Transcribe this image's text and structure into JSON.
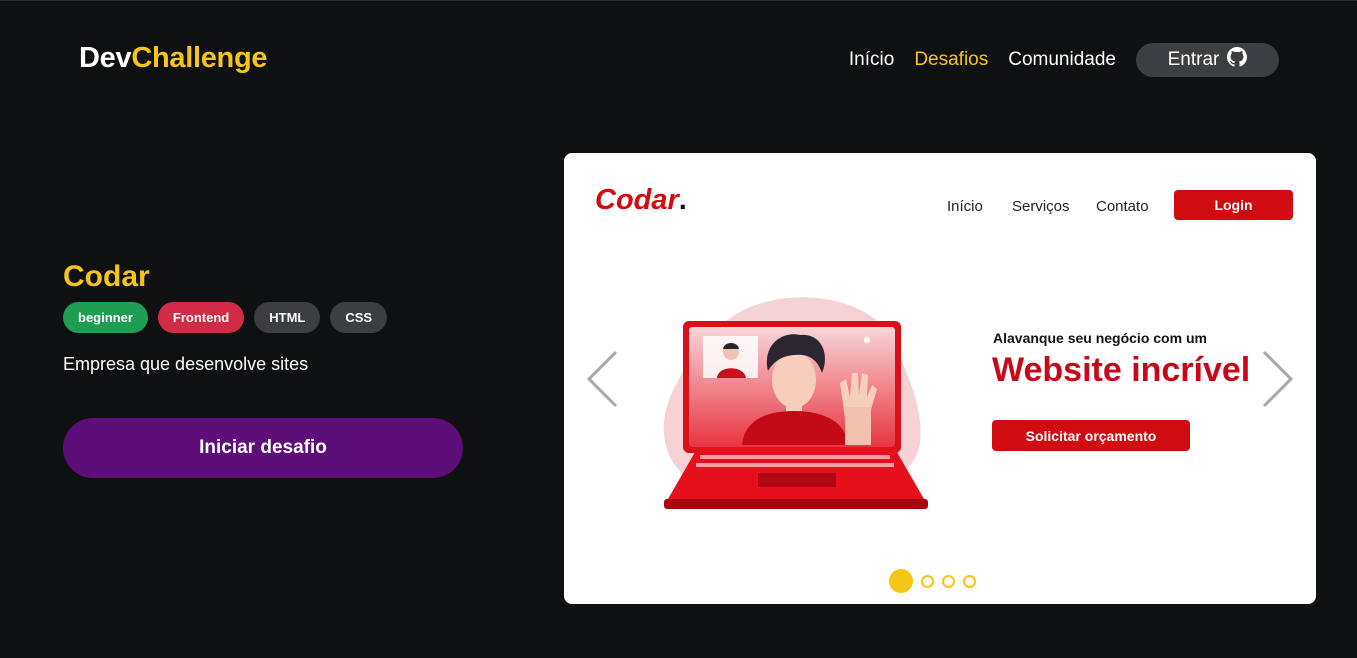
{
  "header": {
    "logo_dev": "Dev",
    "logo_challenge": "Challenge",
    "nav": [
      {
        "label": "Início",
        "active": false
      },
      {
        "label": "Desafios",
        "active": true
      },
      {
        "label": "Comunidade",
        "active": false
      }
    ],
    "login_label": "Entrar",
    "login_icon": "github-icon"
  },
  "challenge": {
    "title": "Codar",
    "tags": [
      {
        "label": "beginner",
        "color": "#1e9e52"
      },
      {
        "label": "Frontend",
        "color": "#d22b46"
      },
      {
        "label": "HTML",
        "color": "#3d3e42"
      },
      {
        "label": "CSS",
        "color": "#3d3e42"
      }
    ],
    "description": "Empresa que desenvolve sites",
    "start_label": "Iniciar desafio"
  },
  "preview": {
    "logo": "Codar",
    "logo_dot": ".",
    "nav": [
      "Início",
      "Serviços",
      "Contato"
    ],
    "login_label": "Login",
    "subheadline": "Alavanque seu negócio com um",
    "headline": "Website incrível",
    "cta_label": "Solicitar orçamento",
    "slides_total": 4,
    "active_slide": 1
  },
  "colors": {
    "background": "#0f1012",
    "accent": "#f5c518",
    "primary_button": "#5d0e79",
    "codar_red": "#d00b12"
  }
}
